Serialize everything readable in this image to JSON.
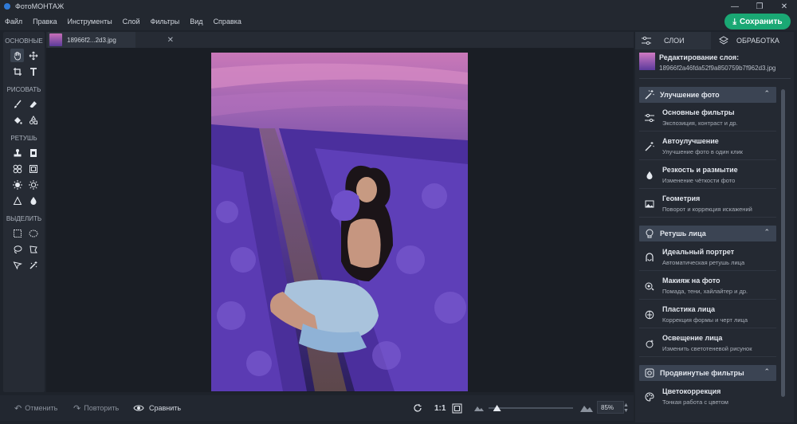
{
  "app": {
    "title": "ФотоМОНТАЖ"
  },
  "menu": [
    "Файл",
    "Правка",
    "Инструменты",
    "Слой",
    "Фильтры",
    "Вид",
    "Справка"
  ],
  "save_label": "Сохранить",
  "toolbar": {
    "sections": [
      "ОСНОВНЫЕ",
      "РИСОВАТЬ",
      "РЕТУШЬ",
      "ВЫДЕЛИТЬ"
    ]
  },
  "file_tab": {
    "name": "18966f2...2d3.jpg"
  },
  "bottom": {
    "undo": "Отменить",
    "redo": "Повторить",
    "compare": "Сравнить",
    "ratio": "1:1",
    "zoom_value": "85%",
    "zoom_fraction": 0.1
  },
  "right_panel": {
    "tabs": [
      "СЛОИ",
      "ОБРАБОТКА"
    ],
    "layer_title": "Редактирование слоя:",
    "layer_file": "18966f2a46fda52f9a850759b7f962d3.jpg",
    "groups": [
      {
        "title": "Улучшение фото",
        "icon": "magic-wand-icon",
        "items": [
          {
            "title": "Основные фильтры",
            "sub": "Экспозиция, контраст и др.",
            "icon": "sliders-icon"
          },
          {
            "title": "Автоулучшение",
            "sub": "Улучшение фото в один клик",
            "icon": "magic-wand-icon"
          },
          {
            "title": "Резкость и размытие",
            "sub": "Изменение чёткости фото",
            "icon": "drop-icon"
          },
          {
            "title": "Геометрия",
            "sub": "Поворот и коррекция искажений",
            "icon": "geometry-icon"
          }
        ]
      },
      {
        "title": "Ретушь лица",
        "icon": "face-icon",
        "items": [
          {
            "title": "Идеальный портрет",
            "sub": "Автоматическая ретушь лица",
            "icon": "portrait-icon"
          },
          {
            "title": "Макияж на фото",
            "sub": "Помада, тени, хайлайтер и др.",
            "icon": "makeup-icon"
          },
          {
            "title": "Пластика лица",
            "sub": "Коррекция формы и черт лица",
            "icon": "face-shape-icon"
          },
          {
            "title": "Освещение лица",
            "sub": "Изменить светотеневой рисунок",
            "icon": "light-face-icon"
          }
        ]
      },
      {
        "title": "Продвинутые фильтры",
        "icon": "advanced-filter-icon",
        "items": [
          {
            "title": "Цветокоррекция",
            "sub": "Тонкая работа с цветом",
            "icon": "palette-icon"
          }
        ]
      }
    ]
  },
  "colors": {
    "accent": "#1aa874",
    "panel": "#242932",
    "group_header": "#3b4453"
  }
}
